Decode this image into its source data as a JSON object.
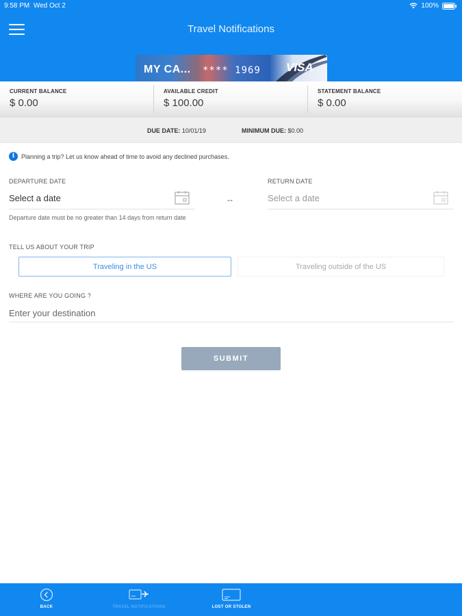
{
  "status": {
    "time": "9:58 PM",
    "date": "Wed Oct 2",
    "battery": "100%"
  },
  "header": {
    "title": "Travel Notifications",
    "menu_icon": "hamburger-menu-icon"
  },
  "card": {
    "name": "MY CA...",
    "number": "**** 1969",
    "brand": "VISA"
  },
  "balances": {
    "current": {
      "label": "CURRENT BALANCE",
      "value": "$ 0.00"
    },
    "available": {
      "label": "AVAILABLE CREDIT",
      "value": "$ 100.00"
    },
    "statement": {
      "label": "STATEMENT BALANCE",
      "value": "$ 0.00"
    }
  },
  "due": {
    "due_label": "DUE DATE:",
    "due_value": "10/01/19",
    "min_label": "MINIMUM DUE:",
    "min_value": "$0.00"
  },
  "form": {
    "info_text": "Planning a trip? Let us know ahead of time to avoid any declined purchases.",
    "departure_label": "DEPARTURE DATE",
    "departure_placeholder": "Select a date",
    "separator": "--",
    "return_label": "RETURN DATE",
    "return_placeholder": "Select a date",
    "hint": "Departure date must be no greater than 14 days from return date",
    "trip_label": "TELL US ABOUT YOUR TRIP",
    "option_us": "Traveling in the US",
    "option_outside": "Traveling outside of the US",
    "destination_label": "WHERE ARE YOU GOING ?",
    "destination_placeholder": "Enter your destination",
    "submit_label": "SUBMIT"
  },
  "tabs": [
    {
      "label": "BACK",
      "icon": "back-arrow-icon"
    },
    {
      "label": "TRAVEL NOTIFICATIONS",
      "icon": "card-plane-icon"
    },
    {
      "label": "LOST OR STOLEN",
      "icon": "card-icon"
    }
  ],
  "colors": {
    "brand_blue": "#1187f0",
    "submit_disabled": "#97a9ba",
    "toggle_active": "#3a8ee6"
  }
}
